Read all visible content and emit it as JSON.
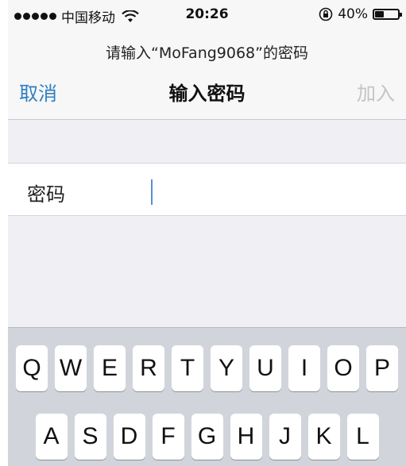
{
  "status_bar": {
    "carrier": "中国移动",
    "time": "20:26",
    "battery_percent_label": "40%",
    "battery_level": 0.4
  },
  "header": {
    "prompt": "请输入“MoFang9068”的密码",
    "cancel_label": "取消",
    "title": "输入密码",
    "join_label": "加入"
  },
  "form": {
    "password_label": "密码",
    "password_value": ""
  },
  "keyboard": {
    "row1": [
      "Q",
      "W",
      "E",
      "R",
      "T",
      "Y",
      "U",
      "I",
      "O",
      "P"
    ],
    "row2": [
      "A",
      "S",
      "D",
      "F",
      "G",
      "H",
      "J",
      "K",
      "L"
    ]
  },
  "colors": {
    "accent": "#2f7fc1",
    "disabled": "#c4c4c6",
    "caret": "#5b8ed9",
    "keyboard_bg": "#d1d5db"
  }
}
